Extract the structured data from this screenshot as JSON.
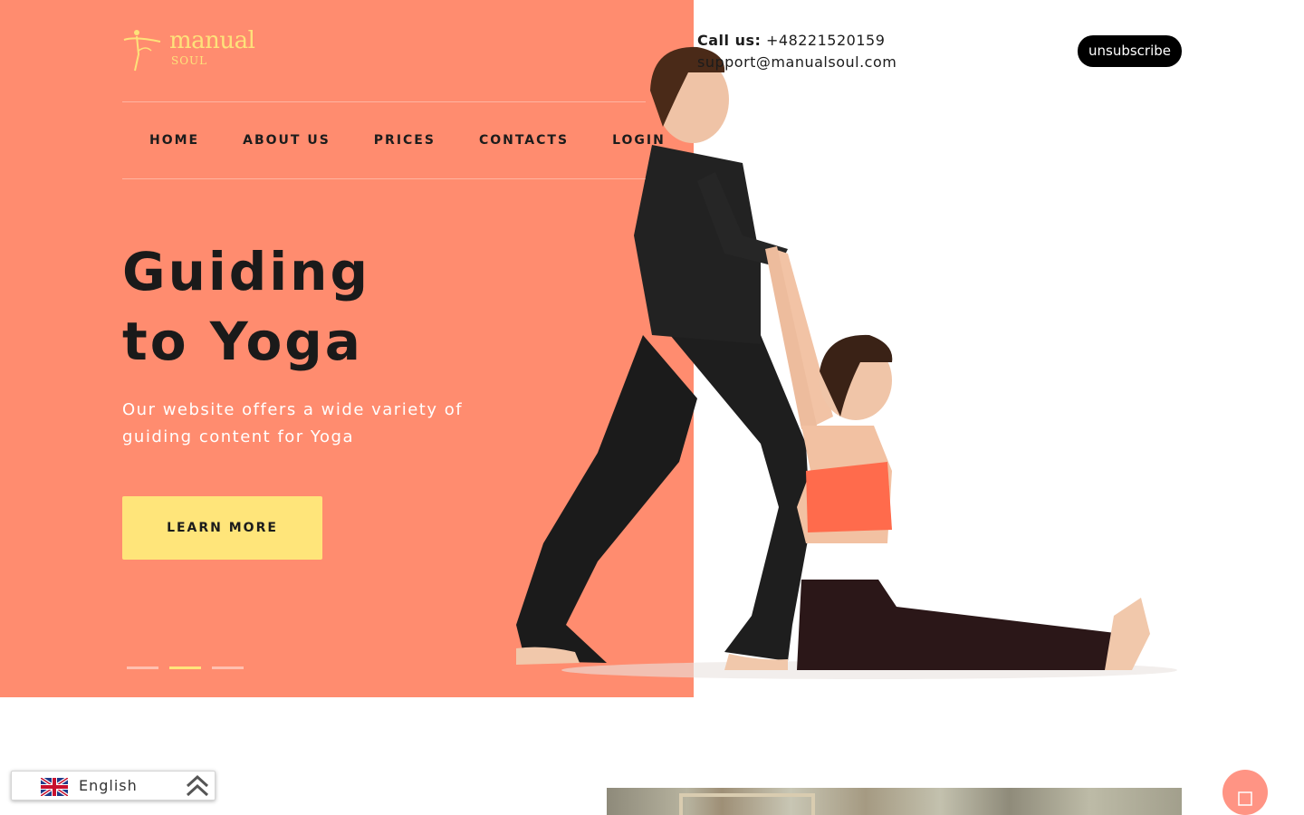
{
  "logo": {
    "main": "manual",
    "sub": "SOUL"
  },
  "contact": {
    "call_label": "Call us:",
    "phone": "+48221520159",
    "email": "support@manualsoul.com"
  },
  "unsubscribe_label": "unsubscribe",
  "nav": [
    {
      "label": "HOME"
    },
    {
      "label": "ABOUT US"
    },
    {
      "label": "PRICES"
    },
    {
      "label": "CONTACTS"
    },
    {
      "label": "LOGIN"
    }
  ],
  "hero": {
    "title_line1": "Guiding",
    "title_line2": "to Yoga",
    "subtitle": "Our website offers a wide variety of guiding content for Yoga",
    "cta_label": "LEARN MORE"
  },
  "slider": {
    "count": 3,
    "active_index": 1
  },
  "language": {
    "label": "English",
    "flag": "uk-flag-icon",
    "chevron": "double-chevron-up-icon"
  },
  "colors": {
    "hero_bg": "#ff8c6f",
    "accent_yellow": "#ffe57a",
    "text_dark": "#1a1a1a",
    "chat_button": "#ff9484"
  },
  "icons": {
    "logo": "yoga-dancer-logo-icon",
    "chat": "chat-icon"
  }
}
